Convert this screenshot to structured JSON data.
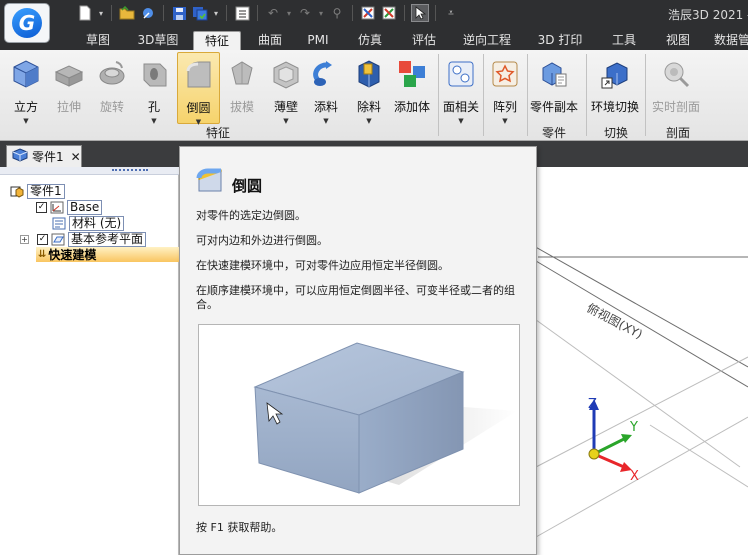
{
  "app": {
    "title": "浩辰3D 2021 - ",
    "logo_icon": "gstarcad-3d-logo-icon"
  },
  "quick_access": [
    {
      "icon": "new-file-icon"
    },
    {
      "icon": "open-folder-icon"
    },
    {
      "icon": "magic-icon"
    },
    {
      "icon": "save-icon"
    },
    {
      "icon": "save-all-icon"
    },
    {
      "icon": "list-icon"
    },
    {
      "icon": "undo-icon"
    },
    {
      "icon": "redo-icon"
    },
    {
      "icon": "wand-icon"
    },
    {
      "icon": "tools-icon"
    },
    {
      "icon": "tools-alt-icon"
    },
    {
      "icon": "cursor-select-icon"
    },
    {
      "icon": "customize-dropdown-icon"
    }
  ],
  "tabs": [
    {
      "label": "草图",
      "active": false
    },
    {
      "label": "3D草图",
      "active": false
    },
    {
      "label": "特征",
      "active": true
    },
    {
      "label": "曲面",
      "active": false
    },
    {
      "label": "PMI",
      "active": false
    },
    {
      "label": "仿真",
      "active": false
    },
    {
      "label": "评估",
      "active": false
    },
    {
      "label": "逆向工程",
      "active": false
    },
    {
      "label": "3D 打印",
      "active": false
    },
    {
      "label": "工具",
      "active": false
    },
    {
      "label": "视图",
      "active": false
    },
    {
      "label": "数据管",
      "active": false
    }
  ],
  "ribbon": {
    "buttons": [
      {
        "label": "立方",
        "icon": "cube-icon",
        "enabled": true
      },
      {
        "label": "拉伸",
        "icon": "extrude-icon",
        "enabled": false
      },
      {
        "label": "旋转",
        "icon": "revolve-icon",
        "enabled": false
      },
      {
        "label": "孔",
        "icon": "hole-icon",
        "enabled": false
      },
      {
        "label": "倒圆",
        "icon": "round-icon",
        "enabled": false,
        "highlighted": true
      },
      {
        "label": "拔模",
        "icon": "draft-icon",
        "enabled": false
      },
      {
        "label": "薄壁",
        "icon": "thin-wall-icon",
        "enabled": false
      },
      {
        "label": "添料",
        "icon": "add-material-icon",
        "enabled": true
      },
      {
        "label": "除料",
        "icon": "remove-material-icon",
        "enabled": true
      },
      {
        "label": "添加体",
        "icon": "add-body-icon",
        "enabled": true
      },
      {
        "label": "面相关",
        "icon": "face-related-icon",
        "enabled": true
      },
      {
        "label": "阵列",
        "icon": "pattern-icon",
        "enabled": true
      },
      {
        "label": "零件副本",
        "icon": "part-copy-icon",
        "enabled": true
      },
      {
        "label": "环境切换",
        "icon": "environment-switch-icon",
        "enabled": true
      },
      {
        "label": "实时剖面",
        "icon": "live-section-icon",
        "enabled": false
      }
    ],
    "groups": [
      "特征",
      "零件",
      "切换",
      "剖面"
    ]
  },
  "document_tab": {
    "label": "零件1",
    "icon": "part-icon",
    "close_icon": "close-icon"
  },
  "pathfinder": {
    "items": [
      {
        "label": "零件1",
        "icon": "part-icon"
      },
      {
        "label": "Base",
        "icon": "coordinate-system-icon",
        "checked": true
      },
      {
        "label": "材料 (无)",
        "icon": "material-icon"
      },
      {
        "label": "基本参考平面",
        "icon": "reference-plane-icon",
        "checked": true,
        "expandable": true
      },
      {
        "label": "快速建模",
        "icon": "sync-modeling-icon"
      }
    ]
  },
  "viewport": {
    "plane_label": "俯视图(XY)",
    "axes": {
      "x": "X",
      "y": "Y",
      "z": "Z"
    },
    "colors": {
      "x": "#e8262a",
      "y": "#2aa52a",
      "z": "#1f3bb5",
      "origin": "#e7d21a"
    }
  },
  "tooltip": {
    "title": "倒圆",
    "icon": "round-icon",
    "lines": [
      "对零件的选定边倒圆。",
      "可对内边和外边进行倒圆。",
      "在快速建模环境中，可对零件边应用恒定半径倒圆。",
      "在顺序建模环境中，可以应用恒定倒圆半径、可变半径或二者的组合。"
    ],
    "help": "按 F1 获取帮助。",
    "preview_icon": "rounded-block-preview-image"
  }
}
